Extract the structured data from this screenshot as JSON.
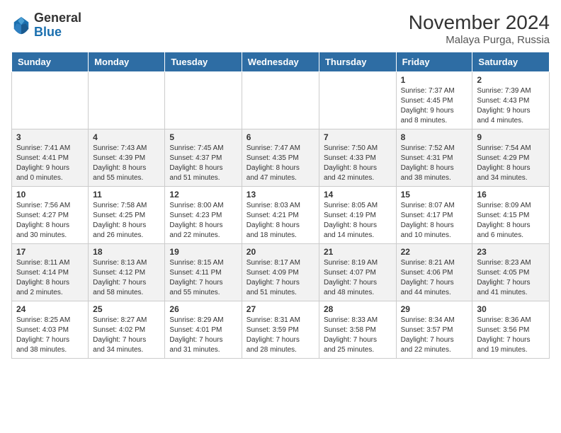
{
  "header": {
    "logo_general": "General",
    "logo_blue": "Blue",
    "month_title": "November 2024",
    "location": "Malaya Purga, Russia"
  },
  "days_of_week": [
    "Sunday",
    "Monday",
    "Tuesday",
    "Wednesday",
    "Thursday",
    "Friday",
    "Saturday"
  ],
  "weeks": [
    [
      {
        "day": "",
        "info": ""
      },
      {
        "day": "",
        "info": ""
      },
      {
        "day": "",
        "info": ""
      },
      {
        "day": "",
        "info": ""
      },
      {
        "day": "",
        "info": ""
      },
      {
        "day": "1",
        "info": "Sunrise: 7:37 AM\nSunset: 4:45 PM\nDaylight: 9 hours\nand 8 minutes."
      },
      {
        "day": "2",
        "info": "Sunrise: 7:39 AM\nSunset: 4:43 PM\nDaylight: 9 hours\nand 4 minutes."
      }
    ],
    [
      {
        "day": "3",
        "info": "Sunrise: 7:41 AM\nSunset: 4:41 PM\nDaylight: 9 hours\nand 0 minutes."
      },
      {
        "day": "4",
        "info": "Sunrise: 7:43 AM\nSunset: 4:39 PM\nDaylight: 8 hours\nand 55 minutes."
      },
      {
        "day": "5",
        "info": "Sunrise: 7:45 AM\nSunset: 4:37 PM\nDaylight: 8 hours\nand 51 minutes."
      },
      {
        "day": "6",
        "info": "Sunrise: 7:47 AM\nSunset: 4:35 PM\nDaylight: 8 hours\nand 47 minutes."
      },
      {
        "day": "7",
        "info": "Sunrise: 7:50 AM\nSunset: 4:33 PM\nDaylight: 8 hours\nand 42 minutes."
      },
      {
        "day": "8",
        "info": "Sunrise: 7:52 AM\nSunset: 4:31 PM\nDaylight: 8 hours\nand 38 minutes."
      },
      {
        "day": "9",
        "info": "Sunrise: 7:54 AM\nSunset: 4:29 PM\nDaylight: 8 hours\nand 34 minutes."
      }
    ],
    [
      {
        "day": "10",
        "info": "Sunrise: 7:56 AM\nSunset: 4:27 PM\nDaylight: 8 hours\nand 30 minutes."
      },
      {
        "day": "11",
        "info": "Sunrise: 7:58 AM\nSunset: 4:25 PM\nDaylight: 8 hours\nand 26 minutes."
      },
      {
        "day": "12",
        "info": "Sunrise: 8:00 AM\nSunset: 4:23 PM\nDaylight: 8 hours\nand 22 minutes."
      },
      {
        "day": "13",
        "info": "Sunrise: 8:03 AM\nSunset: 4:21 PM\nDaylight: 8 hours\nand 18 minutes."
      },
      {
        "day": "14",
        "info": "Sunrise: 8:05 AM\nSunset: 4:19 PM\nDaylight: 8 hours\nand 14 minutes."
      },
      {
        "day": "15",
        "info": "Sunrise: 8:07 AM\nSunset: 4:17 PM\nDaylight: 8 hours\nand 10 minutes."
      },
      {
        "day": "16",
        "info": "Sunrise: 8:09 AM\nSunset: 4:15 PM\nDaylight: 8 hours\nand 6 minutes."
      }
    ],
    [
      {
        "day": "17",
        "info": "Sunrise: 8:11 AM\nSunset: 4:14 PM\nDaylight: 8 hours\nand 2 minutes."
      },
      {
        "day": "18",
        "info": "Sunrise: 8:13 AM\nSunset: 4:12 PM\nDaylight: 7 hours\nand 58 minutes."
      },
      {
        "day": "19",
        "info": "Sunrise: 8:15 AM\nSunset: 4:11 PM\nDaylight: 7 hours\nand 55 minutes."
      },
      {
        "day": "20",
        "info": "Sunrise: 8:17 AM\nSunset: 4:09 PM\nDaylight: 7 hours\nand 51 minutes."
      },
      {
        "day": "21",
        "info": "Sunrise: 8:19 AM\nSunset: 4:07 PM\nDaylight: 7 hours\nand 48 minutes."
      },
      {
        "day": "22",
        "info": "Sunrise: 8:21 AM\nSunset: 4:06 PM\nDaylight: 7 hours\nand 44 minutes."
      },
      {
        "day": "23",
        "info": "Sunrise: 8:23 AM\nSunset: 4:05 PM\nDaylight: 7 hours\nand 41 minutes."
      }
    ],
    [
      {
        "day": "24",
        "info": "Sunrise: 8:25 AM\nSunset: 4:03 PM\nDaylight: 7 hours\nand 38 minutes."
      },
      {
        "day": "25",
        "info": "Sunrise: 8:27 AM\nSunset: 4:02 PM\nDaylight: 7 hours\nand 34 minutes."
      },
      {
        "day": "26",
        "info": "Sunrise: 8:29 AM\nSunset: 4:01 PM\nDaylight: 7 hours\nand 31 minutes."
      },
      {
        "day": "27",
        "info": "Sunrise: 8:31 AM\nSunset: 3:59 PM\nDaylight: 7 hours\nand 28 minutes."
      },
      {
        "day": "28",
        "info": "Sunrise: 8:33 AM\nSunset: 3:58 PM\nDaylight: 7 hours\nand 25 minutes."
      },
      {
        "day": "29",
        "info": "Sunrise: 8:34 AM\nSunset: 3:57 PM\nDaylight: 7 hours\nand 22 minutes."
      },
      {
        "day": "30",
        "info": "Sunrise: 8:36 AM\nSunset: 3:56 PM\nDaylight: 7 hours\nand 19 minutes."
      }
    ]
  ]
}
